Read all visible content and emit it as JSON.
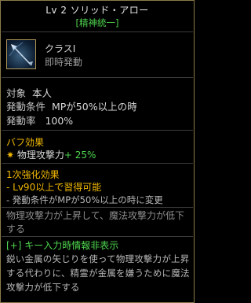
{
  "tooltip": {
    "title": "Lv 2 ソリッド・アロー",
    "subtitle": "[精神統一]",
    "icon": "arrow-skill-icon",
    "class_label": "クラスI",
    "cast_type": "即時発動",
    "target_key": "対象",
    "target_value": "本人",
    "condition_key": "発動条件",
    "condition_value": "MPが50%以上の時",
    "rate_key": "発動率",
    "rate_value": "100%",
    "buff_header": "バフ効果",
    "buff_star": "✷",
    "buff_stat": "物理攻撃力",
    "buff_value": "+ 25%",
    "enhance_header": "1次強化効果",
    "enhance_req": "- Lv90以上で習得可能",
    "enhance_change": "- 発動条件がMPが50%以上の時に変更",
    "description": "物理攻撃力が上昇して、魔法攻撃力が低下する",
    "toggle_hint": "[+] キー入力時情報非表示",
    "flavor_text": "鋭い金属の矢じりを使って物理攻撃力が上昇する代わりに、精霊が金属を嫌うために魔法攻撃力が低下する"
  },
  "colors": {
    "border": "#8a7a4a",
    "green": "#4fd64f",
    "gold": "#f0b800",
    "grey_text": "#8c8c8c"
  }
}
